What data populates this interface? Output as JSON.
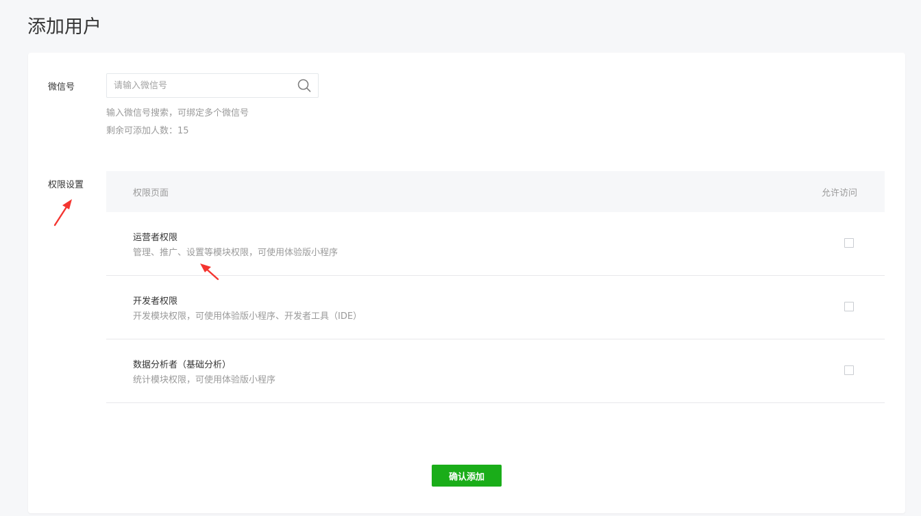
{
  "page": {
    "title": "添加用户"
  },
  "form": {
    "wechat_label": "微信号",
    "search": {
      "placeholder": "请输入微信号",
      "value": ""
    },
    "hint_bind": "输入微信号搜索，可绑定多个微信号",
    "hint_remaining": "剩余可添加人数：15",
    "permission_label": "权限设置"
  },
  "permission_table": {
    "header_page": "权限页面",
    "header_access": "允许访问",
    "rows": [
      {
        "title": "运营者权限",
        "description": "管理、推广、设置等模块权限，可使用体验版小程序",
        "checked": false
      },
      {
        "title": "开发者权限",
        "description": "开发模块权限，可使用体验版小程序、开发者工具（IDE）",
        "checked": false
      },
      {
        "title": "数据分析者（基础分析）",
        "description": "统计模块权限，可使用体验版小程序",
        "checked": false
      }
    ]
  },
  "actions": {
    "confirm_label": "确认添加"
  },
  "colors": {
    "primary_button": "#1aad19",
    "annotation_arrow": "#f43530",
    "page_background": "#f6f7f9"
  },
  "icons": {
    "search": "search-icon",
    "annotation": "red-arrow-icon"
  }
}
